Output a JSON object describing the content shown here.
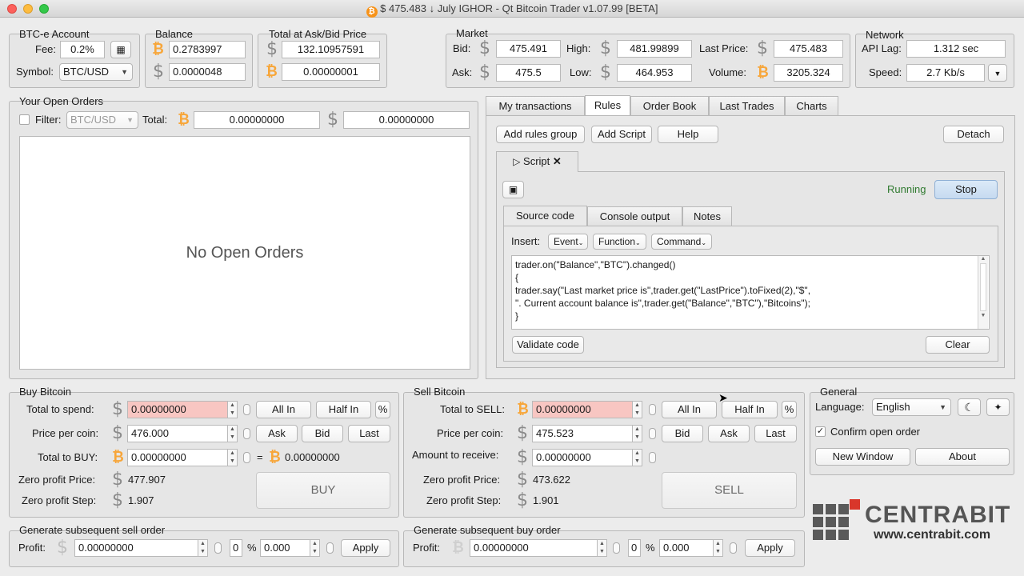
{
  "window": {
    "title_price": "$ 475.483",
    "title_rest": "↓ July IGHOR - Qt Bitcoin Trader v1.07.99 [BETA]"
  },
  "account": {
    "group_label": "BTC-e Account",
    "fee_label": "Fee:",
    "fee_value": "0.2%",
    "symbol_label": "Symbol:",
    "symbol_value": "BTC/USD"
  },
  "balance": {
    "group_label": "Balance",
    "btc": "0.2783997",
    "usd": "0.0000048"
  },
  "total_at_price": {
    "group_label": "Total at Ask/Bid Price",
    "usd": "132.10957591",
    "btc": "0.00000001"
  },
  "market": {
    "group_label": "Market",
    "bid_label": "Bid:",
    "bid": "475.491",
    "high_label": "High:",
    "high": "481.99899",
    "last_label": "Last Price:",
    "last": "475.483",
    "ask_label": "Ask:",
    "ask": "475.5",
    "low_label": "Low:",
    "low": "464.953",
    "volume_label": "Volume:",
    "volume": "3205.324"
  },
  "network": {
    "group_label": "Network",
    "lag_label": "API Lag:",
    "lag": "1.312 sec",
    "speed_label": "Speed:",
    "speed": "2.7 Kb/s"
  },
  "open_orders": {
    "group_label": "Your Open Orders",
    "filter_label": "Filter:",
    "filter_value": "BTC/USD",
    "total_label": "Total:",
    "total_btc": "0.00000000",
    "total_usd": "0.00000000",
    "empty_text": "No Open Orders"
  },
  "tabs": [
    "My transactions",
    "Rules",
    "Order Book",
    "Last Trades",
    "Charts"
  ],
  "rules": {
    "add_group": "Add rules group",
    "add_script": "Add Script",
    "help": "Help",
    "detach": "Detach",
    "script_tab": "Script",
    "status": "Running",
    "stop": "Stop",
    "inner_tabs": [
      "Source code",
      "Console output",
      "Notes"
    ],
    "insert_label": "Insert:",
    "event": "Event",
    "function": "Function",
    "command": "Command",
    "code_lines": [
      "trader.on(\"Balance\",\"BTC\").changed()",
      "{",
      "trader.say(\"Last market price is\",trader.get(\"LastPrice\").toFixed(2),\"$\",",
      "\". Current account balance is\",trader.get(\"Balance\",\"BTC\"),\"Bitcoins\");",
      "}"
    ],
    "validate": "Validate code",
    "clear": "Clear"
  },
  "buy": {
    "group_label": "Buy Bitcoin",
    "spend_label": "Total to spend:",
    "spend": "0.00000000",
    "all_in": "All In",
    "half_in": "Half In",
    "pct": "%",
    "price_label": "Price per coin:",
    "price": "476.000",
    "ask": "Ask",
    "bid": "Bid",
    "last": "Last",
    "total_label": "Total to BUY:",
    "total": "0.00000000",
    "equals": "=",
    "result": "0.00000000",
    "zero_price_label": "Zero profit Price:",
    "zero_price": "477.907",
    "zero_step_label": "Zero profit Step:",
    "zero_step": "1.907",
    "button": "BUY"
  },
  "sell": {
    "group_label": "Sell Bitcoin",
    "sell_label": "Total to SELL:",
    "sell": "0.00000000",
    "all_in": "All In",
    "half_in": "Half In",
    "pct": "%",
    "price_label": "Price per coin:",
    "price": "475.523",
    "bid": "Bid",
    "ask": "Ask",
    "last": "Last",
    "receive_label": "Amount to receive:",
    "receive": "0.00000000",
    "zero_price_label": "Zero profit Price:",
    "zero_price": "473.622",
    "zero_step_label": "Zero profit Step:",
    "zero_step": "1.901",
    "button": "SELL"
  },
  "general": {
    "group_label": "General",
    "language_label": "Language:",
    "language": "English",
    "confirm_label": "Confirm open order",
    "new_window": "New Window",
    "about": "About"
  },
  "gen_sell": {
    "group_label": "Generate subsequent sell order",
    "profit_label": "Profit:",
    "profit": "0.00000000",
    "count": "0",
    "pct": "%",
    "pct_value": "0.000",
    "apply": "Apply"
  },
  "gen_buy": {
    "group_label": "Generate subsequent buy order",
    "profit_label": "Profit:",
    "profit": "0.00000000",
    "count": "0",
    "pct": "%",
    "pct_value": "0.000",
    "apply": "Apply"
  },
  "brand": {
    "name": "CENTRABIT",
    "url": "www.centrabit.com",
    "accent": "#d9362b"
  }
}
